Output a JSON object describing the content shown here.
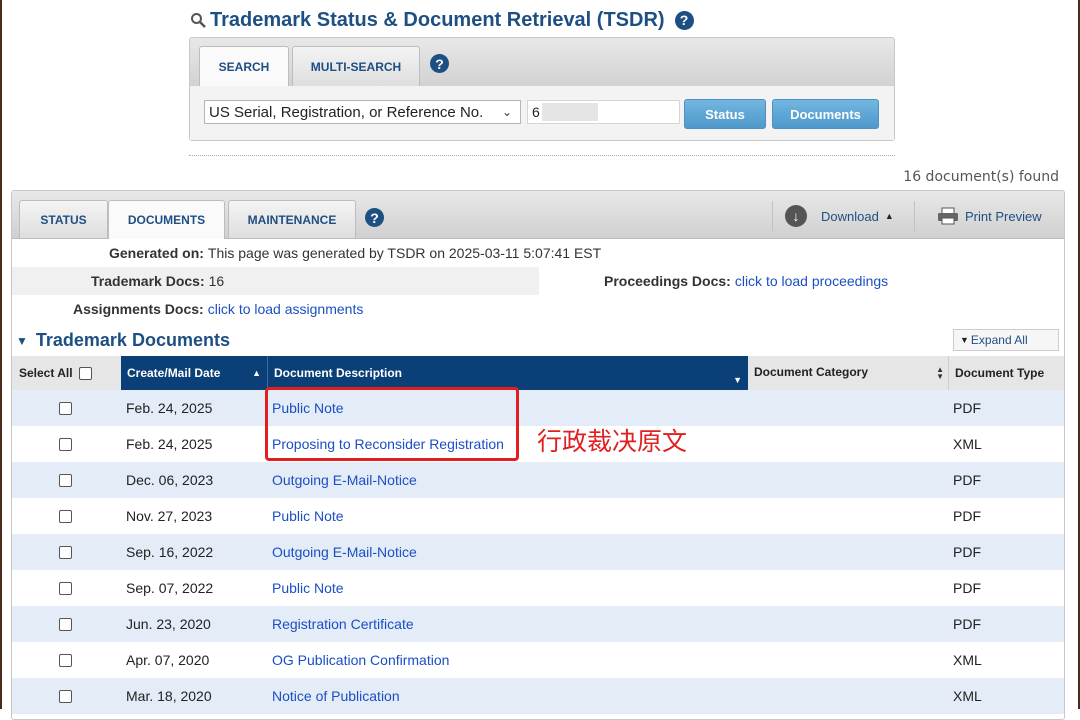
{
  "header": {
    "title": "Trademark Status & Document Retrieval (TSDR)"
  },
  "search": {
    "tabs": [
      {
        "label": "SEARCH",
        "active": true
      },
      {
        "label": "MULTI-SEARCH",
        "active": false
      }
    ],
    "type_select": "US Serial, Registration, or Reference No.",
    "number_value": "6",
    "status_button": "Status",
    "documents_button": "Documents"
  },
  "results": {
    "count_text": "16 document(s) found",
    "tabs": [
      {
        "label": "STATUS",
        "active": false
      },
      {
        "label": "DOCUMENTS",
        "active": true
      },
      {
        "label": "MAINTENANCE",
        "active": false
      }
    ],
    "download_label": "Download",
    "print_label": "Print Preview",
    "generated_label": "Generated on:",
    "generated_value": "This page was generated by TSDR on 2025-03-11 5:07:41 EST",
    "tm_docs_label": "Trademark Docs:",
    "tm_docs_value": "16",
    "proceedings_label": "Proceedings Docs:",
    "proceedings_link": "click to load proceedings",
    "assignments_label": "Assignments Docs:",
    "assignments_link": "click to load assignments",
    "section_title": "Trademark Documents",
    "expand_all": "Expand All"
  },
  "table": {
    "headers": {
      "select_all": "Select All",
      "date": "Create/Mail Date",
      "description": "Document Description",
      "category": "Document Category",
      "type": "Document Type"
    },
    "rows": [
      {
        "date": "Feb. 24, 2025",
        "description": "Public Note",
        "category": "",
        "type": "PDF"
      },
      {
        "date": "Feb. 24, 2025",
        "description": "Proposing to Reconsider Registration",
        "category": "",
        "type": "XML"
      },
      {
        "date": "Dec. 06, 2023",
        "description": "Outgoing E-Mail-Notice",
        "category": "",
        "type": "PDF"
      },
      {
        "date": "Nov. 27, 2023",
        "description": "Public Note",
        "category": "",
        "type": "PDF"
      },
      {
        "date": "Sep. 16, 2022",
        "description": "Outgoing E-Mail-Notice",
        "category": "",
        "type": "PDF"
      },
      {
        "date": "Sep. 07, 2022",
        "description": "Public Note",
        "category": "",
        "type": "PDF"
      },
      {
        "date": "Jun. 23, 2020",
        "description": "Registration Certificate",
        "category": "",
        "type": "PDF"
      },
      {
        "date": "Apr. 07, 2020",
        "description": "OG Publication Confirmation",
        "category": "",
        "type": "XML"
      },
      {
        "date": "Mar. 18, 2020",
        "description": "Notice of Publication",
        "category": "",
        "type": "XML"
      }
    ]
  },
  "annotation": {
    "note": "行政裁决原文",
    "color": "#e02020"
  },
  "colors": {
    "brand": "#1e4f83",
    "header_dark": "#0b3f78",
    "row_alt": "#e3ecf7",
    "link": "#1a4fc4",
    "button": "#4e98cb"
  },
  "icons": [
    "search-icon",
    "help-icon",
    "download-icon",
    "printer-icon",
    "chevron-down-icon",
    "sort-icon"
  ]
}
